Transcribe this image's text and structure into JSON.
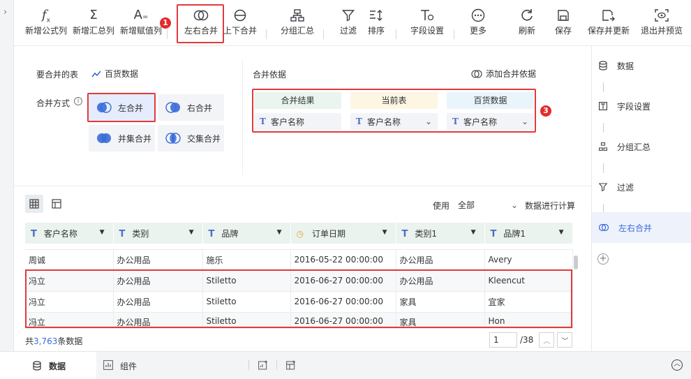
{
  "toolbar": {
    "items": [
      {
        "label": "新增公式列",
        "icon": "formula-icon"
      },
      {
        "label": "新增汇总列",
        "icon": "sigma-icon"
      },
      {
        "label": "新增赋值列",
        "icon": "assign-icon"
      },
      {
        "label": "左右合并",
        "icon": "left-right-merge-icon"
      },
      {
        "label": "上下合并",
        "icon": "top-bottom-merge-icon"
      },
      {
        "label": "分组汇总",
        "icon": "group-summary-icon"
      },
      {
        "label": "过滤",
        "icon": "filter-icon"
      },
      {
        "label": "排序",
        "icon": "sort-icon"
      },
      {
        "label": "字段设置",
        "icon": "field-settings-icon"
      },
      {
        "label": "更多",
        "icon": "more-icon"
      },
      {
        "label": "刷新",
        "icon": "refresh-icon"
      },
      {
        "label": "保存",
        "icon": "save-icon"
      },
      {
        "label": "保存并更新",
        "icon": "save-update-icon"
      },
      {
        "label": "退出并预览",
        "icon": "exit-preview-icon"
      }
    ]
  },
  "badges": [
    "1",
    "2",
    "3"
  ],
  "config": {
    "table_label": "要合并的表",
    "table_name": "百货数据",
    "method_label": "合并方式",
    "methods": [
      "左合并",
      "右合并",
      "并集合并",
      "交集合并"
    ],
    "basis_label": "合并依据",
    "add_basis": "添加合并依据",
    "basis_columns": [
      {
        "head": "合并结果",
        "field": "客户名称",
        "color": "#e9f5ee"
      },
      {
        "head": "当前表",
        "field": "客户名称",
        "color": "#fcf6e3"
      },
      {
        "head": "百货数据",
        "field": "客户名称",
        "color": "#e9f5fb"
      }
    ]
  },
  "table_tools": {
    "use_label": "使用",
    "use_value": "全部",
    "calc_label": "数据进行计算"
  },
  "grid": {
    "headers": [
      "客户名称",
      "类别",
      "品牌",
      "订单日期",
      "类别1",
      "品牌1"
    ],
    "rows": [
      [
        "周诚",
        "办公用品",
        "施乐",
        "2016-05-22 00:00:00",
        "办公用品",
        "Avery"
      ],
      [
        "冯立",
        "办公用品",
        "Stiletto",
        "2016-06-27 00:00:00",
        "办公用品",
        "Kleencut"
      ],
      [
        "冯立",
        "办公用品",
        "Stiletto",
        "2016-06-27 00:00:00",
        "家具",
        "宜家"
      ],
      [
        "冯立",
        "办公用品",
        "Stiletto",
        "2016-06-27 00:00:00",
        "家具",
        "Hon"
      ]
    ]
  },
  "footer": {
    "prefix": "共",
    "count": "3,763",
    "suffix": "条数据",
    "page": "1",
    "total_pages": "/38"
  },
  "steps": [
    "数据",
    "字段设置",
    "分组汇总",
    "过滤",
    "左右合并"
  ],
  "bottom_tabs": [
    "数据",
    "组件"
  ],
  "colors": {
    "accent": "#3a6cd8",
    "highlight": "#e03b3b",
    "grid_header": "#eaf3ee"
  }
}
